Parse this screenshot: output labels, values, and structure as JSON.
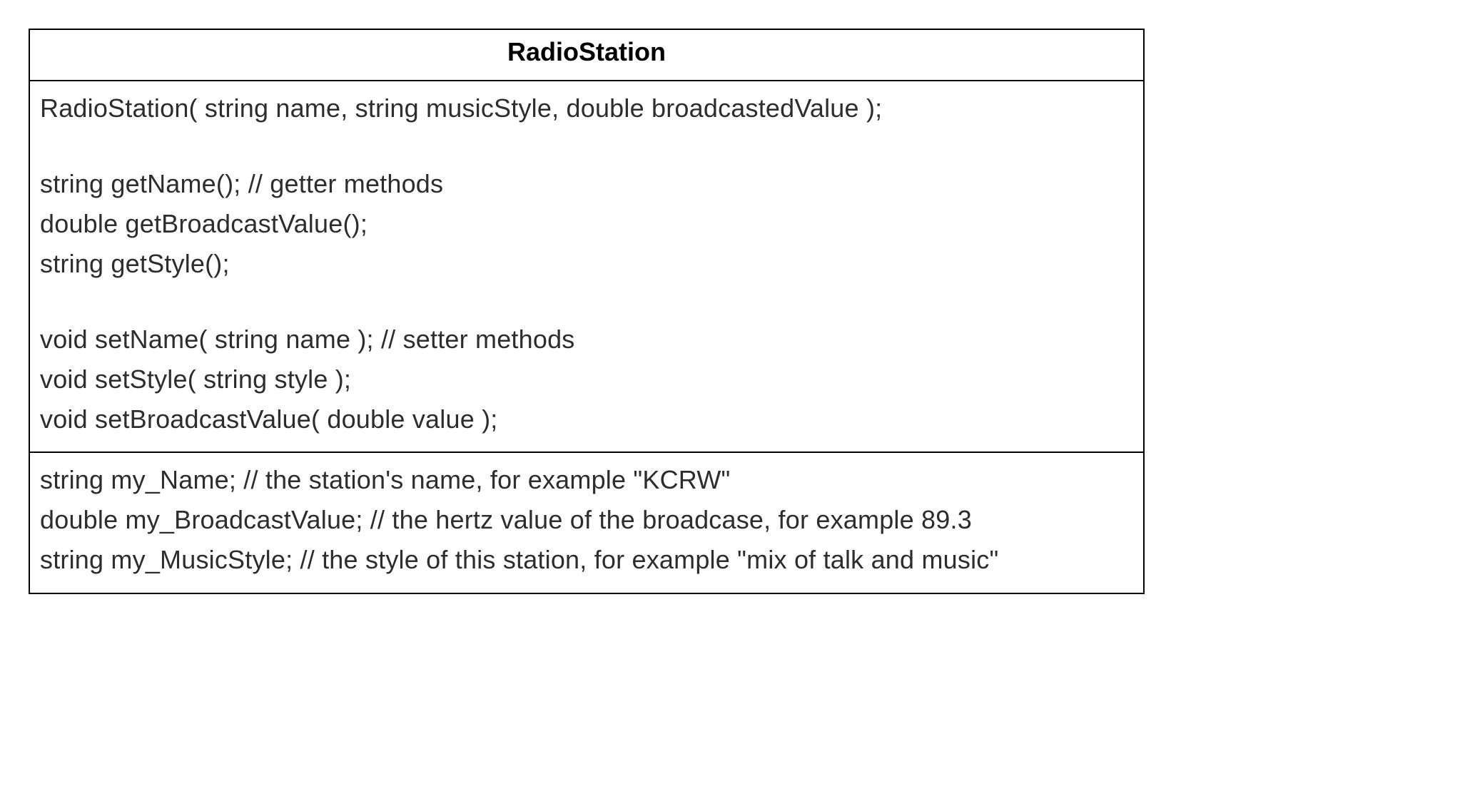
{
  "class": {
    "name": "RadioStation",
    "methods": [
      "RadioStation( string name, string musicStyle, double broadcastedValue );",
      "",
      "string getName(); // getter methods",
      "double getBroadcastValue();",
      "string getStyle();",
      "",
      "void setName( string name ); // setter methods",
      "void setStyle( string style );",
      "void setBroadcastValue( double value );"
    ],
    "attributes": [
      "string my_Name; // the station's name, for example \"KCRW\"",
      "double my_BroadcastValue; // the hertz value of the broadcase, for example 89.3",
      "string my_MusicStyle; // the style of this station, for example \"mix of talk and music\""
    ]
  }
}
